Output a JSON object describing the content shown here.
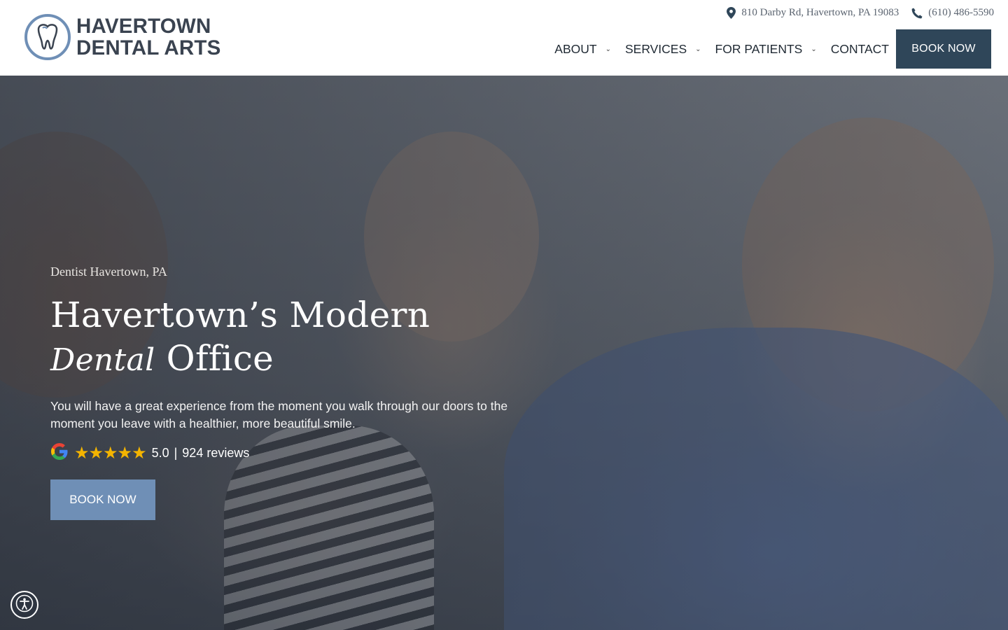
{
  "brand": {
    "line1": "HAVERTOWN",
    "line2": "DENTAL ARTS",
    "accent": "#2f4659",
    "ring": "#6f8fb6"
  },
  "topbar": {
    "address": "810 Darby Rd, Havertown, PA 19083",
    "phone": "(610) 486-5590"
  },
  "nav": {
    "items": [
      {
        "label": "ABOUT"
      },
      {
        "label": "SERVICES"
      },
      {
        "label": "FOR PATIENTS"
      },
      {
        "label": "CONTACT"
      }
    ],
    "book_label": "BOOK NOW"
  },
  "hero": {
    "eyebrow": "Dentist Havertown, PA",
    "headline_line1": "Havertown’s Modern",
    "headline_script": "Dental",
    "headline_line2_rest": "Office",
    "subtext": "You will have a great experience from the moment you walk through our doors to the moment you leave with a healthier, more beautiful smile.",
    "rating_value": "5.0",
    "rating_sep": "|",
    "reviews": "924 reviews",
    "stars": "★★★★★",
    "button_label": "BOOK NOW"
  },
  "icons": {
    "location": "map-pin-icon",
    "phone": "phone-icon",
    "google": "google-icon",
    "accessibility": "accessibility-icon"
  }
}
